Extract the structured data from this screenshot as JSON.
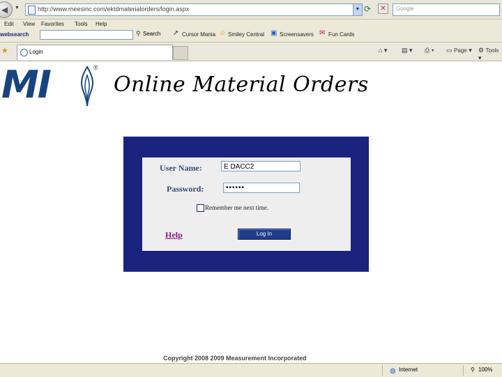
{
  "browser": {
    "address_url": "http://www.meesinc.com/ektdmaterialorders/login.aspx",
    "search_placeholder": "Google",
    "menu": [
      "Edit",
      "View",
      "Favorites",
      "Tools",
      "Help"
    ],
    "toolbar": {
      "websearch_label": "websearch",
      "search_button": "Search",
      "buttons": [
        "Cursor Mania",
        "Smiley Central",
        "Screensavers",
        "Fun Cards"
      ]
    },
    "tab_title": "Login",
    "commands": {
      "page": "Page",
      "tools": "Tools"
    },
    "status": {
      "zone": "Internet",
      "zoom": "100%"
    }
  },
  "page": {
    "logo_text": "MI",
    "logo_reg": "®",
    "title": "Online Material Orders",
    "login": {
      "username_label": "User Name:",
      "username_value": "E DACC2",
      "password_label": "Password:",
      "password_value": "••••••",
      "remember_label": "Remember me next time.",
      "help_label": "Help",
      "login_button": "Log In"
    },
    "copyright": "Copyright 2008 2009 Measurement Incorporated"
  },
  "colors": {
    "login_frame": "#1a237e",
    "logo_blue": "#17447e",
    "help_link": "#8b1a8b"
  }
}
